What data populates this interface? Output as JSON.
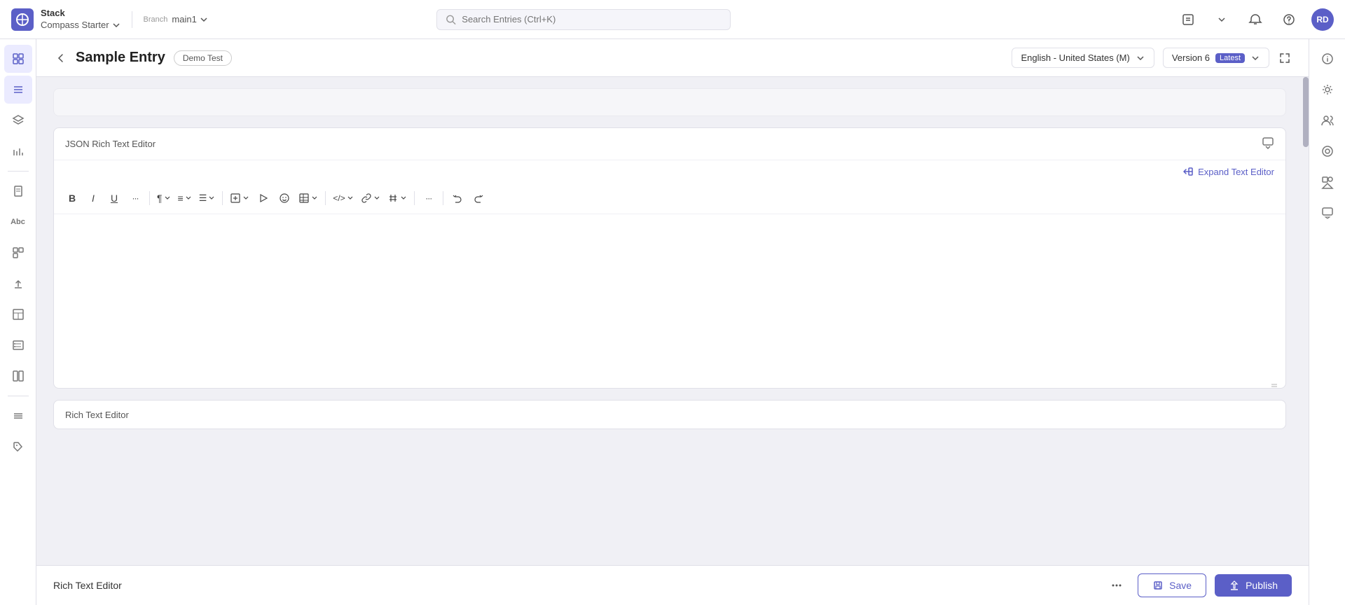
{
  "app": {
    "logo_label": "Stack\nCompass Starter",
    "logo_title": "Stack",
    "logo_subtitle": "Compass Starter",
    "branch_label": "Branch",
    "branch_value": "main1",
    "search_placeholder": "Search Entries (Ctrl+K)",
    "avatar_initials": "RD"
  },
  "entry_header": {
    "back_label": "back",
    "title": "Sample Entry",
    "badge": "Demo Test",
    "locale": "English - United States (M)",
    "version": "Version 6",
    "version_badge": "Latest"
  },
  "json_rte": {
    "label": "JSON Rich Text Editor",
    "expand_label": "Expand Text Editor",
    "toolbar": {
      "bold": "B",
      "italic": "I",
      "underline": "U",
      "more": "···",
      "paragraph": "¶",
      "align": "≡",
      "list": "≔",
      "insert": "⬚",
      "media": "▶",
      "emoji": "☺",
      "table": "⊞",
      "code": "</>",
      "link": "🔗",
      "hash": "#",
      "more2": "···",
      "undo": "↩",
      "redo": "↪"
    }
  },
  "rich_text_editor": {
    "label": "Rich Text Editor"
  },
  "actions": {
    "save_label": "Save",
    "publish_label": "Publish"
  },
  "sidebar_items": [
    {
      "name": "dashboard-icon",
      "symbol": "⊞"
    },
    {
      "name": "list-icon",
      "symbol": "☰"
    },
    {
      "name": "layers-icon",
      "symbol": "◫"
    },
    {
      "name": "chart-icon",
      "symbol": "📊"
    },
    {
      "name": "document-icon",
      "symbol": "📄"
    },
    {
      "name": "text-icon",
      "symbol": "Aa"
    },
    {
      "name": "component-icon",
      "symbol": "⊡"
    },
    {
      "name": "upload-icon",
      "symbol": "↑"
    },
    {
      "name": "layout-icon",
      "symbol": "▦"
    },
    {
      "name": "form-icon",
      "symbol": "📋"
    },
    {
      "name": "grid-icon",
      "symbol": "⊞"
    },
    {
      "name": "data-icon",
      "symbol": "≡"
    },
    {
      "name": "tag-icon",
      "symbol": "🏷"
    }
  ],
  "right_panel_items": [
    {
      "name": "info-icon",
      "symbol": "ⓘ"
    },
    {
      "name": "settings-icon",
      "symbol": "⚙"
    },
    {
      "name": "people-icon",
      "symbol": "👥"
    },
    {
      "name": "radio-icon",
      "symbol": "◉"
    },
    {
      "name": "shapes-icon",
      "symbol": "◇"
    },
    {
      "name": "chat-icon",
      "symbol": "💬"
    }
  ]
}
